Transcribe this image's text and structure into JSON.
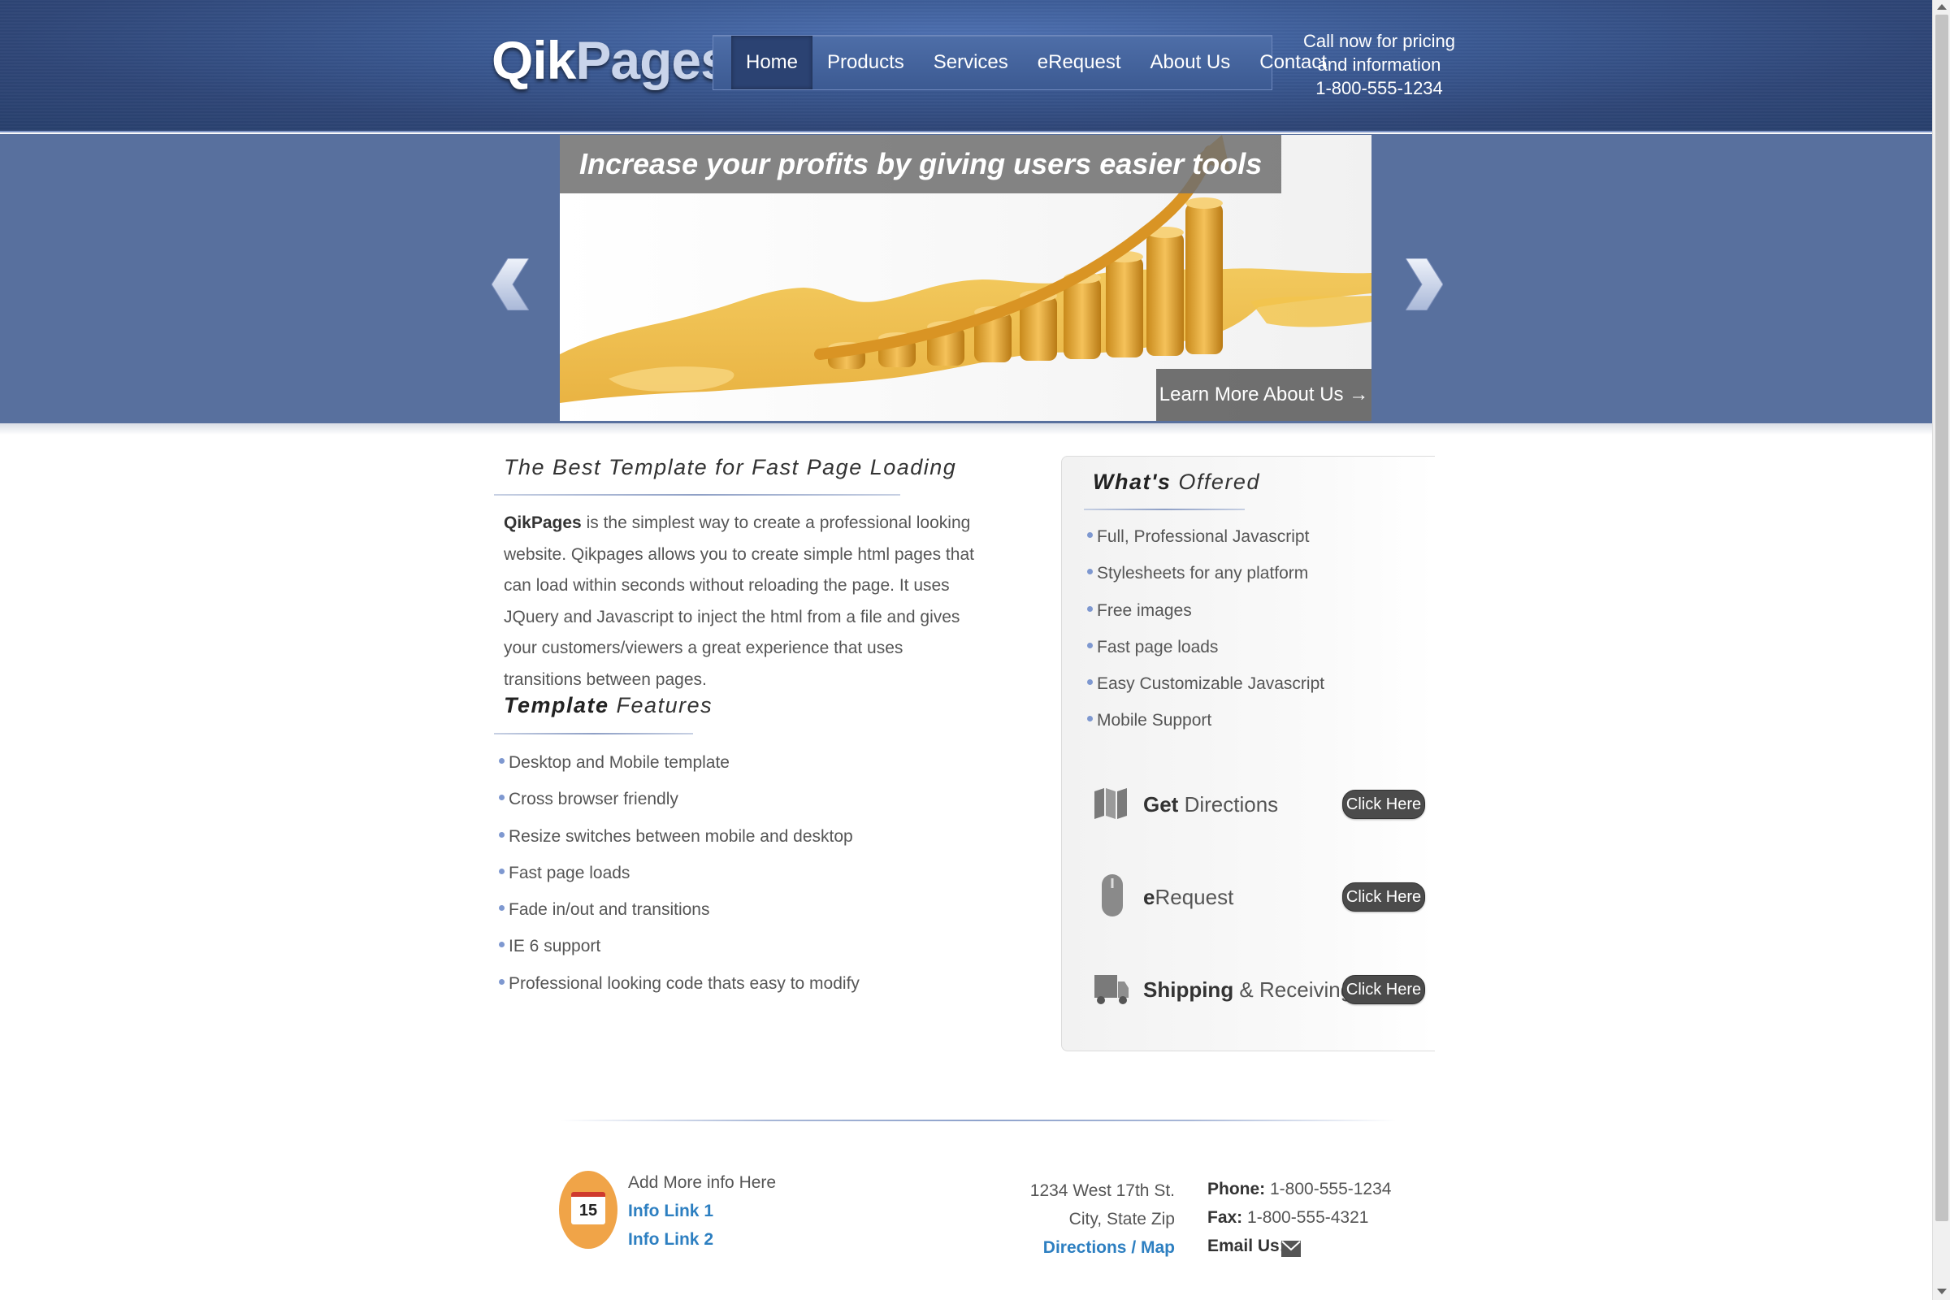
{
  "header": {
    "logo_part1": "Qik",
    "logo_part2": "Pages",
    "nav": [
      "Home",
      "Products",
      "Services",
      "eRequest",
      "About Us",
      "Contact"
    ],
    "active_nav": "Home",
    "call_line1": "Call now for pricing",
    "call_line2": "and information",
    "call_phone": "1-800-555-1234"
  },
  "banner": {
    "caption": "Increase your profits by giving users easier tools",
    "learn_more": "Learn More About Us →"
  },
  "main": {
    "heading1": "The Best Template for Fast Page Loading",
    "intro_bold": "QikPages",
    "intro_text": " is the simplest way to create a professional looking website. Qikpages allows you to create simple html pages that can load within seconds without reloading the page. It uses JQuery and Javascript to inject the html from a file and gives your customers/viewers a great experience that uses transitions between pages.",
    "heading2_bold": "Template",
    "heading2_rest": " Features",
    "features": [
      "Desktop and Mobile template",
      "Cross browser friendly",
      "Resize switches between mobile and desktop",
      "Fast page loads",
      "Fade in/out and transitions",
      "IE 6 support",
      "Professional looking code thats easy to modify"
    ]
  },
  "panel": {
    "heading_bold": "What's",
    "heading_rest": " Offered",
    "offered": [
      "Full, Professional Javascript",
      "Stylesheets for any platform",
      "Free images",
      "Fast page loads",
      "Easy Customizable Javascript",
      "Mobile Support"
    ],
    "directions_bold": "Get",
    "directions_rest": " Directions",
    "erequest_bold": "e",
    "erequest_rest": "Request",
    "shipping_bold": "Shipping",
    "shipping_rest": " & Receiving",
    "click_here": "Click Here"
  },
  "footer": {
    "calendar_day": "15",
    "add_info": "Add More info Here",
    "info_link1": "Info Link 1",
    "info_link2": "Info Link 2",
    "address1": "1234 West 17th St.",
    "address2": "City, State Zip",
    "directions_link": "Directions / Map",
    "phone_label": "Phone:",
    "phone": " 1-800-555-1234",
    "fax_label": "Fax:",
    "fax": " 1-800-555-4321",
    "email_label": "Email Us:"
  },
  "colors": {
    "header_blue": "#3b5a94",
    "banner_blue": "#58709e",
    "link_blue": "#2d7fc1",
    "calendar_orange": "#f0a448",
    "button_dark": "#4b4b4b"
  },
  "icons": [
    "arrow-left-icon",
    "arrow-right-icon",
    "map-icon",
    "mouse-icon",
    "truck-icon",
    "calendar-icon",
    "envelope-icon"
  ]
}
